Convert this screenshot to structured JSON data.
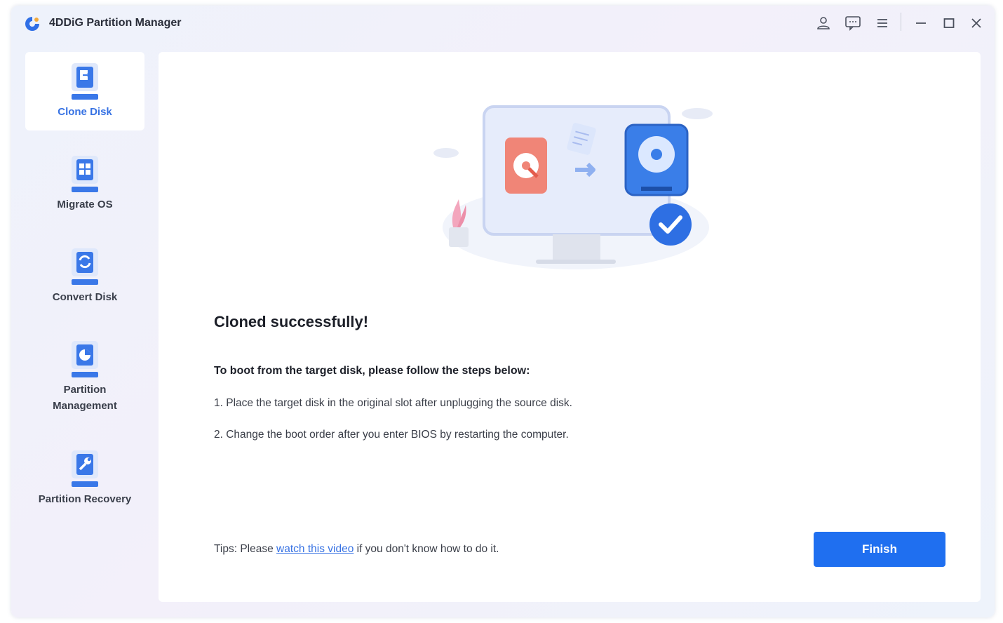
{
  "titlebar": {
    "title": "4DDiG Partition Manager",
    "icons": [
      "user-icon",
      "feedback-icon",
      "menu-icon",
      "minimize-icon",
      "maximize-icon",
      "close-icon"
    ]
  },
  "sidebar": {
    "items": [
      {
        "label": "Clone Disk",
        "icon": "clone-disk-icon",
        "active": true
      },
      {
        "label": "Migrate OS",
        "icon": "migrate-os-icon",
        "active": false
      },
      {
        "label": "Convert Disk",
        "icon": "convert-disk-icon",
        "active": false
      },
      {
        "label": "Partition\nManagement",
        "label_line1": "Partition",
        "label_line2": "Management",
        "icon": "partition-management-icon",
        "active": false
      },
      {
        "label": "Partition Recovery",
        "icon": "partition-recovery-icon",
        "active": false
      }
    ]
  },
  "main": {
    "success_title": "Cloned successfully!",
    "steps_title": "To boot from the target disk, please follow the steps below:",
    "steps": [
      "1. Place the target disk in the original slot after unplugging the source disk.",
      "2. Change the boot order after you enter BIOS by restarting the computer."
    ],
    "tips_prefix": "Tips: Please ",
    "tips_link": "watch this video",
    "tips_suffix": " if you don't know how to do it.",
    "finish_label": "Finish"
  },
  "colors": {
    "accent": "#1f6ff0",
    "active_nav": "#3772e3",
    "source_disk": "#f08577",
    "target_disk": "#3a7ee8"
  }
}
